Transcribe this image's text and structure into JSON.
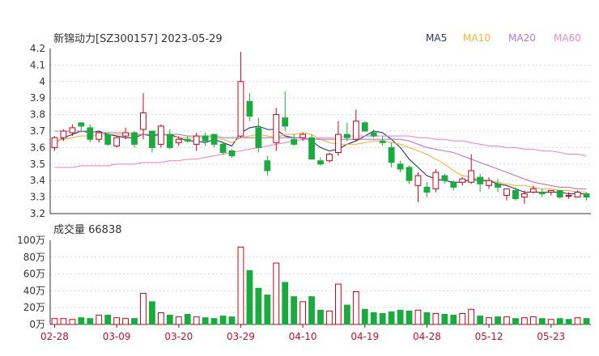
{
  "chart_title": "新锦动力[SZ300157] 2023-05-29",
  "legend": [
    {
      "label": "MA5",
      "color": "#2a3570"
    },
    {
      "label": "MA10",
      "color": "#f5b53a"
    },
    {
      "label": "MA20",
      "color": "#b27ad6"
    },
    {
      "label": "MA60",
      "color": "#f08bc7"
    }
  ],
  "volume_title": "成交量 66838",
  "chart_data": [
    {
      "type": "candlestick",
      "title": "新锦动力[SZ300157] 2023-05-29",
      "ylim": [
        3.2,
        4.2
      ],
      "y_ticks": [
        "4.2",
        "4.1",
        "4",
        "3.9",
        "3.8",
        "3.7",
        "3.6",
        "3.5",
        "3.4",
        "3.3",
        "3.2"
      ],
      "x_labels": [
        "02-28",
        "03-09",
        "03-20",
        "03-29",
        "04-10",
        "04-19",
        "04-28",
        "05-12",
        "05-23"
      ],
      "x_label_index": [
        0,
        7,
        14,
        21,
        28,
        35,
        42,
        49,
        56
      ],
      "colors": {
        "up": "#d0021b",
        "down": "#1aab3f"
      },
      "ohlc": [
        [
          3.6,
          3.67,
          3.58,
          3.66
        ],
        [
          3.66,
          3.71,
          3.64,
          3.7
        ],
        [
          3.69,
          3.74,
          3.67,
          3.72
        ],
        [
          3.75,
          3.75,
          3.69,
          3.73
        ],
        [
          3.72,
          3.74,
          3.63,
          3.65
        ],
        [
          3.65,
          3.7,
          3.63,
          3.69
        ],
        [
          3.68,
          3.69,
          3.61,
          3.62
        ],
        [
          3.61,
          3.67,
          3.6,
          3.66
        ],
        [
          3.67,
          3.72,
          3.65,
          3.69
        ],
        [
          3.69,
          3.7,
          3.6,
          3.62
        ],
        [
          3.71,
          3.93,
          3.65,
          3.81
        ],
        [
          3.7,
          3.7,
          3.57,
          3.6
        ],
        [
          3.62,
          3.74,
          3.6,
          3.73
        ],
        [
          3.68,
          3.71,
          3.59,
          3.6
        ],
        [
          3.63,
          3.67,
          3.61,
          3.65
        ],
        [
          3.65,
          3.67,
          3.63,
          3.64
        ],
        [
          3.62,
          3.69,
          3.58,
          3.67
        ],
        [
          3.67,
          3.69,
          3.61,
          3.64
        ],
        [
          3.68,
          3.68,
          3.6,
          3.62
        ],
        [
          3.62,
          3.63,
          3.56,
          3.57
        ],
        [
          3.58,
          3.59,
          3.54,
          3.55
        ],
        [
          3.67,
          4.18,
          3.66,
          4.0
        ],
        [
          3.88,
          3.93,
          3.76,
          3.79
        ],
        [
          3.72,
          3.78,
          3.57,
          3.6
        ],
        [
          3.52,
          3.55,
          3.43,
          3.46
        ],
        [
          3.63,
          3.84,
          3.58,
          3.8
        ],
        [
          3.78,
          3.94,
          3.7,
          3.73
        ],
        [
          3.65,
          3.68,
          3.61,
          3.62
        ],
        [
          3.66,
          3.69,
          3.64,
          3.68
        ],
        [
          3.66,
          3.68,
          3.57,
          3.53
        ],
        [
          3.52,
          3.54,
          3.49,
          3.5
        ],
        [
          3.52,
          3.57,
          3.51,
          3.56
        ],
        [
          3.57,
          3.76,
          3.55,
          3.68
        ],
        [
          3.68,
          3.75,
          3.64,
          3.66
        ],
        [
          3.65,
          3.83,
          3.64,
          3.76
        ],
        [
          3.75,
          3.76,
          3.7,
          3.7
        ],
        [
          3.69,
          3.71,
          3.66,
          3.67
        ],
        [
          3.64,
          3.67,
          3.61,
          3.63
        ],
        [
          3.6,
          3.63,
          3.48,
          3.51
        ],
        [
          3.5,
          3.52,
          3.45,
          3.47
        ],
        [
          3.48,
          3.49,
          3.38,
          3.4
        ],
        [
          3.37,
          3.45,
          3.27,
          3.43
        ],
        [
          3.36,
          3.39,
          3.3,
          3.33
        ],
        [
          3.35,
          3.47,
          3.33,
          3.45
        ],
        [
          3.43,
          3.44,
          3.38,
          3.4
        ],
        [
          3.39,
          3.4,
          3.34,
          3.36
        ],
        [
          3.39,
          3.42,
          3.37,
          3.41
        ],
        [
          3.39,
          3.56,
          3.38,
          3.46
        ],
        [
          3.42,
          3.44,
          3.33,
          3.38
        ],
        [
          3.37,
          3.42,
          3.35,
          3.4
        ],
        [
          3.38,
          3.41,
          3.33,
          3.36
        ],
        [
          3.31,
          3.34,
          3.28,
          3.35
        ],
        [
          3.34,
          3.36,
          3.28,
          3.29
        ],
        [
          3.3,
          3.34,
          3.26,
          3.32
        ],
        [
          3.33,
          3.37,
          3.32,
          3.35
        ],
        [
          3.33,
          3.35,
          3.3,
          3.32
        ],
        [
          3.33,
          3.34,
          3.31,
          3.34
        ],
        [
          3.34,
          3.34,
          3.29,
          3.3
        ],
        [
          3.31,
          3.33,
          3.29,
          3.31
        ],
        [
          3.3,
          3.34,
          3.3,
          3.33
        ],
        [
          3.32,
          3.33,
          3.28,
          3.3
        ]
      ],
      "series": [
        {
          "label": "MA5",
          "color": "#2a3570",
          "values": [
            3.63,
            3.66,
            3.68,
            3.7,
            3.69,
            3.7,
            3.68,
            3.67,
            3.66,
            3.66,
            3.68,
            3.67,
            3.68,
            3.68,
            3.66,
            3.64,
            3.64,
            3.63,
            3.65,
            3.63,
            3.61,
            3.69,
            3.72,
            3.73,
            3.71,
            3.71,
            3.67,
            3.66,
            3.66,
            3.64,
            3.6,
            3.58,
            3.59,
            3.62,
            3.64,
            3.67,
            3.7,
            3.69,
            3.65,
            3.6,
            3.53,
            3.48,
            3.43,
            3.41,
            3.4,
            3.39,
            3.39,
            3.41,
            3.4,
            3.4,
            3.38,
            3.37,
            3.35,
            3.33,
            3.33,
            3.33,
            3.33,
            3.33,
            3.32,
            3.32,
            3.32
          ]
        },
        {
          "label": "MA10",
          "color": "#f5b53a",
          "values": [
            3.64,
            3.65,
            3.66,
            3.67,
            3.67,
            3.68,
            3.68,
            3.68,
            3.68,
            3.67,
            3.68,
            3.68,
            3.68,
            3.67,
            3.66,
            3.66,
            3.66,
            3.66,
            3.66,
            3.65,
            3.63,
            3.66,
            3.67,
            3.68,
            3.67,
            3.66,
            3.68,
            3.68,
            3.69,
            3.68,
            3.65,
            3.63,
            3.62,
            3.62,
            3.62,
            3.63,
            3.64,
            3.64,
            3.63,
            3.62,
            3.6,
            3.58,
            3.56,
            3.53,
            3.5,
            3.46,
            3.43,
            3.42,
            3.41,
            3.4,
            3.39,
            3.38,
            3.37,
            3.37,
            3.36,
            3.35,
            3.35,
            3.34,
            3.34,
            3.33,
            3.33
          ]
        },
        {
          "label": "MA20",
          "color": "#b27ad6",
          "values": [
            3.7,
            3.7,
            3.7,
            3.7,
            3.7,
            3.69,
            3.69,
            3.69,
            3.69,
            3.68,
            3.68,
            3.68,
            3.68,
            3.68,
            3.68,
            3.67,
            3.67,
            3.67,
            3.67,
            3.66,
            3.66,
            3.66,
            3.66,
            3.66,
            3.66,
            3.66,
            3.66,
            3.66,
            3.66,
            3.65,
            3.65,
            3.65,
            3.65,
            3.65,
            3.65,
            3.65,
            3.65,
            3.65,
            3.65,
            3.65,
            3.64,
            3.62,
            3.6,
            3.59,
            3.58,
            3.57,
            3.55,
            3.53,
            3.51,
            3.49,
            3.47,
            3.45,
            3.43,
            3.41,
            3.39,
            3.38,
            3.37,
            3.36,
            3.36,
            3.35,
            3.35
          ]
        },
        {
          "label": "MA60",
          "color": "#f08bc7",
          "values": [
            3.48,
            3.48,
            3.48,
            3.49,
            3.49,
            3.49,
            3.49,
            3.5,
            3.5,
            3.5,
            3.51,
            3.51,
            3.51,
            3.52,
            3.52,
            3.53,
            3.53,
            3.54,
            3.55,
            3.56,
            3.57,
            3.58,
            3.59,
            3.6,
            3.61,
            3.62,
            3.63,
            3.64,
            3.65,
            3.65,
            3.66,
            3.66,
            3.66,
            3.67,
            3.67,
            3.67,
            3.67,
            3.67,
            3.67,
            3.67,
            3.67,
            3.66,
            3.66,
            3.65,
            3.65,
            3.64,
            3.64,
            3.63,
            3.62,
            3.61,
            3.61,
            3.6,
            3.6,
            3.59,
            3.59,
            3.58,
            3.58,
            3.57,
            3.56,
            3.56,
            3.55
          ]
        }
      ]
    },
    {
      "type": "bar",
      "title": "成交量 66838",
      "ylim": [
        0,
        100
      ],
      "y_ticks": [
        "100万",
        "80万",
        "60万",
        "40万",
        "20万",
        "0万"
      ],
      "unit": "万",
      "volumes": [
        7,
        7,
        6,
        8,
        7,
        11,
        11,
        8,
        7,
        7,
        37,
        27,
        14,
        11,
        9,
        12,
        9,
        8,
        7,
        10,
        9,
        92,
        64,
        43,
        35,
        73,
        50,
        33,
        27,
        33,
        17,
        16,
        48,
        23,
        39,
        18,
        14,
        13,
        15,
        17,
        16,
        17,
        14,
        13,
        12,
        11,
        13,
        18,
        10,
        8,
        9,
        9,
        7,
        8,
        9,
        7,
        6,
        7,
        6,
        8,
        7
      ],
      "up": [
        true,
        true,
        true,
        false,
        false,
        true,
        false,
        true,
        true,
        false,
        true,
        false,
        true,
        false,
        true,
        false,
        true,
        false,
        false,
        false,
        false,
        true,
        false,
        false,
        false,
        true,
        false,
        false,
        true,
        false,
        false,
        true,
        true,
        false,
        true,
        false,
        false,
        false,
        false,
        false,
        false,
        true,
        false,
        true,
        false,
        false,
        true,
        true,
        false,
        true,
        false,
        true,
        false,
        true,
        true,
        false,
        true,
        false,
        false,
        true,
        false
      ]
    }
  ]
}
